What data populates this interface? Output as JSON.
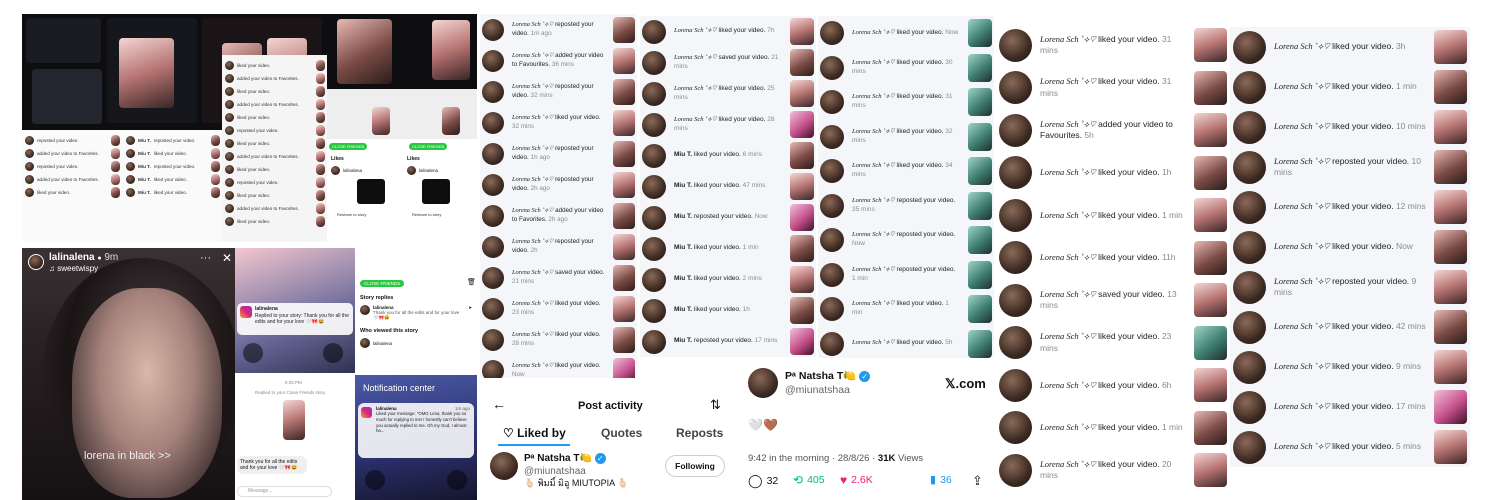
{
  "colors": {
    "accent_blue": "#1d9bf0",
    "like_pink": "#f91880",
    "retweet_green": "#00ba7c",
    "ig_green": "#28c840"
  },
  "collage_top": {
    "rows_left": [
      {
        "name": "Lorena Sch",
        "action": "reposted your video."
      },
      {
        "name": "Lorena Sch",
        "action": "added your video to Favorites."
      },
      {
        "name": "Lorena Sch",
        "action": "reposted your video."
      },
      {
        "name": "Lorena Sch",
        "action": "added your video to Favorites."
      },
      {
        "name": "Lorena Sch",
        "action": "liked your video."
      }
    ],
    "rows_mid": [
      {
        "name": "Miu T.",
        "action": "reposted your video."
      },
      {
        "name": "Miu T.",
        "action": "liked your video."
      },
      {
        "name": "Miu T.",
        "action": "reposted your video."
      },
      {
        "name": "Miu T.",
        "action": "liked your video."
      },
      {
        "name": "Miu T.",
        "action": "liked your video."
      }
    ],
    "likes_label": "Likes",
    "user": "lalinalena",
    "close_friends": "CLOSE FRIENDS",
    "reshare": "Reshare to story"
  },
  "story": {
    "username": "lalinalena",
    "verified_dot": "●",
    "time": "9m",
    "music": "sweetwispy",
    "more": "···",
    "close": "✕",
    "caption": "lorena in black >>"
  },
  "ig_panel": {
    "notif_user": "lalinalena",
    "notif_text": "Replied to your story: Thank you for all the edits and for your love 🤍🎀😆",
    "time": "8:26 PM",
    "reply_label": "Replied to your Close Friends story",
    "bubble": "Thank you for all the edits and for your love 🤍🎀😆",
    "message_placeholder": "Message..."
  },
  "ig_replies": {
    "close_friends": "CLOSE FRIENDS",
    "story_replies": "Story replies",
    "reply_user": "lalinalena",
    "reply_text": "Thank you for all the edits and for your love 🤍🎀😆",
    "who_viewed": "Who viewed this story",
    "viewer": "lalinalena"
  },
  "notif_center": {
    "title": "Notification center",
    "user": "lalinalena",
    "time": "1m ago",
    "text": "Liked your message: \"OMG Lena, thank you so much for replying to me! I honestly can't believe you actually replied to me. Oh my God, I almost ha..."
  },
  "col1": [
    {
      "name": "Lorena Sch ˚⟡♡",
      "action": "reposted your video.",
      "time": "1m ago"
    },
    {
      "name": "Lorena Sch ˚⟡♡",
      "action": "added your video to Favourites.",
      "time": "36 mins"
    },
    {
      "name": "Lorena Sch ˚⟡♡",
      "action": "reposted your video.",
      "time": "32 mins"
    },
    {
      "name": "Lorena Sch ˚⟡♡",
      "action": "liked your video.",
      "time": "32 mins"
    },
    {
      "name": "Lorena Sch ˚⟡♡",
      "action": "reposted your video.",
      "time": "1h ago"
    },
    {
      "name": "Lorena Sch ˚⟡♡",
      "action": "reposted your video.",
      "time": "2h ago"
    },
    {
      "name": "Lorena Sch ˚⟡♡",
      "action": "added your video to Favorites.",
      "time": "2h ago"
    },
    {
      "name": "Lorena Sch ˚⟡♡",
      "action": "reposted your video.",
      "time": "2h"
    },
    {
      "name": "Lorena Sch ˚⟡♡",
      "action": "saved your video.",
      "time": "21 mins"
    },
    {
      "name": "Lorena Sch ˚⟡♡",
      "action": "liked your video.",
      "time": "23 mins"
    },
    {
      "name": "Lorena Sch ˚⟡♡",
      "action": "liked your video.",
      "time": "28 mins"
    },
    {
      "name": "Lorena Sch ˚⟡♡",
      "action": "liked your video.",
      "time": "Now"
    }
  ],
  "col2": [
    {
      "name": "Lorena Sch ˚⟡♡",
      "action": "liked your video.",
      "time": "7h"
    },
    {
      "name": "Lorena Sch ˚⟡♡",
      "action": "saved your video.",
      "time": "21 mins"
    },
    {
      "name": "Lorena Sch ˚⟡♡",
      "action": "liked your video.",
      "time": "25 mins"
    },
    {
      "name": "Lorena Sch ˚⟡♡",
      "action": "liked your video.",
      "time": "28 mins"
    },
    {
      "name": "Miu T.",
      "action": "liked your video.",
      "time": "6 mins"
    },
    {
      "name": "Miu T.",
      "action": "liked your video.",
      "time": "47 mins"
    },
    {
      "name": "Miu T.",
      "action": "reposted your video.",
      "time": "Now"
    },
    {
      "name": "Miu T.",
      "action": "liked your video.",
      "time": "1 min"
    },
    {
      "name": "Miu T.",
      "action": "liked your video.",
      "time": "2 mins"
    },
    {
      "name": "Miu T.",
      "action": "liked your video.",
      "time": "1h"
    },
    {
      "name": "Miu T.",
      "action": "reposted your video.",
      "time": "17 mins"
    }
  ],
  "col3": [
    {
      "name": "Lorena Sch ˚⟡♡",
      "action": "liked your video.",
      "time": "Now"
    },
    {
      "name": "Lorena Sch ˚⟡♡",
      "action": "liked your video.",
      "time": "30 mins"
    },
    {
      "name": "Lorena Sch ˚⟡♡",
      "action": "liked your video.",
      "time": "31 mins"
    },
    {
      "name": "Lorena Sch ˚⟡♡",
      "action": "liked your video.",
      "time": "32 mins"
    },
    {
      "name": "Lorena Sch ˚⟡♡",
      "action": "liked your video.",
      "time": "34 mins"
    },
    {
      "name": "Lorena Sch ˚⟡♡",
      "action": "reposted your video.",
      "time": "35 mins"
    },
    {
      "name": "Lorena Sch ˚⟡♡",
      "action": "reposted your video.",
      "time": "Now"
    },
    {
      "name": "Lorena Sch ˚⟡♡",
      "action": "reposted your video.",
      "time": "1 min"
    },
    {
      "name": "Lorena Sch ˚⟡♡",
      "action": "liked your video.",
      "time": "1 min"
    },
    {
      "name": "Lorena Sch ˚⟡♡",
      "action": "liked your video.",
      "time": "5h"
    }
  ],
  "post_activity": {
    "back": "←",
    "title": "Post activity",
    "sort": "⇅",
    "tabs": [
      "Liked by",
      "Quotes",
      "Reposts"
    ],
    "user_name": "Pᵃ Natsha T",
    "user_emoji": "🍋",
    "user_handle": "@miunatshaa",
    "user_bio": "🫰🏻 พิมมิ์ มิอู MIUTOPIA 🫰🏻",
    "follow": "Following"
  },
  "tweet": {
    "name": "Pᵃ Natsha T",
    "emoji": "🍋",
    "handle": "@miunatshaa",
    "brand": "𝕏.com",
    "body": "🤍🤎",
    "time": "9:42 in the morning · 28/8/26 ·",
    "views_count": "31K",
    "views_label": "Views",
    "replies": "32",
    "reposts": "405",
    "likes": "2.6K",
    "bookmarks": "36"
  },
  "col4": [
    {
      "name": "Lorena Sch ˚⟡♡",
      "action": "liked your video.",
      "time": "31 mins"
    },
    {
      "name": "Lorena Sch ˚⟡♡",
      "action": "liked your video.",
      "time": "31 mins"
    },
    {
      "name": "Lorena Sch ˚⟡♡",
      "action": "added your video to Favourites.",
      "time": "5h"
    },
    {
      "name": "Lorena Sch ˚⟡♡",
      "action": "liked your video.",
      "time": "1h"
    },
    {
      "name": "Lorena Sch ˚⟡♡",
      "action": "liked your video.",
      "time": "1 min"
    },
    {
      "name": "Lorena Sch ˚⟡♡",
      "action": "liked your video.",
      "time": "11h"
    },
    {
      "name": "Lorena Sch ˚⟡♡",
      "action": "saved your video.",
      "time": "13 mins"
    },
    {
      "name": "Lorena Sch ˚⟡♡",
      "action": "liked your video.",
      "time": "23 mins"
    },
    {
      "name": "Lorena Sch ˚⟡♡",
      "action": "liked your video.",
      "time": "6h"
    },
    {
      "name": "Lorena Sch ˚⟡♡",
      "action": "liked your video.",
      "time": "1 min"
    },
    {
      "name": "Lorena Sch ˚⟡♡",
      "action": "liked your video.",
      "time": "20 mins"
    }
  ],
  "col5": [
    {
      "name": "Lorena Sch ˚⟡♡",
      "action": "liked your video.",
      "time": "3h"
    },
    {
      "name": "Lorena Sch ˚⟡♡",
      "action": "liked your video.",
      "time": "1 min"
    },
    {
      "name": "Lorena Sch ˚⟡♡",
      "action": "liked your video.",
      "time": "10 mins"
    },
    {
      "name": "Lorena Sch ˚⟡♡",
      "action": "reposted your video.",
      "time": "10 mins"
    },
    {
      "name": "Lorena Sch ˚⟡♡",
      "action": "liked your video.",
      "time": "12 mins"
    },
    {
      "name": "Lorena Sch ˚⟡♡",
      "action": "liked your video.",
      "time": "Now"
    },
    {
      "name": "Lorena Sch ˚⟡♡",
      "action": "reposted your video.",
      "time": "9 mins"
    },
    {
      "name": "Lorena Sch ˚⟡♡",
      "action": "liked your video.",
      "time": "42 mins"
    },
    {
      "name": "Lorena Sch ˚⟡♡",
      "action": "liked your video.",
      "time": "9 mins"
    },
    {
      "name": "Lorena Sch ˚⟡♡",
      "action": "liked your video.",
      "time": "17 mins"
    },
    {
      "name": "Lorena Sch ˚⟡♡",
      "action": "liked your video.",
      "time": "5 mins"
    }
  ]
}
